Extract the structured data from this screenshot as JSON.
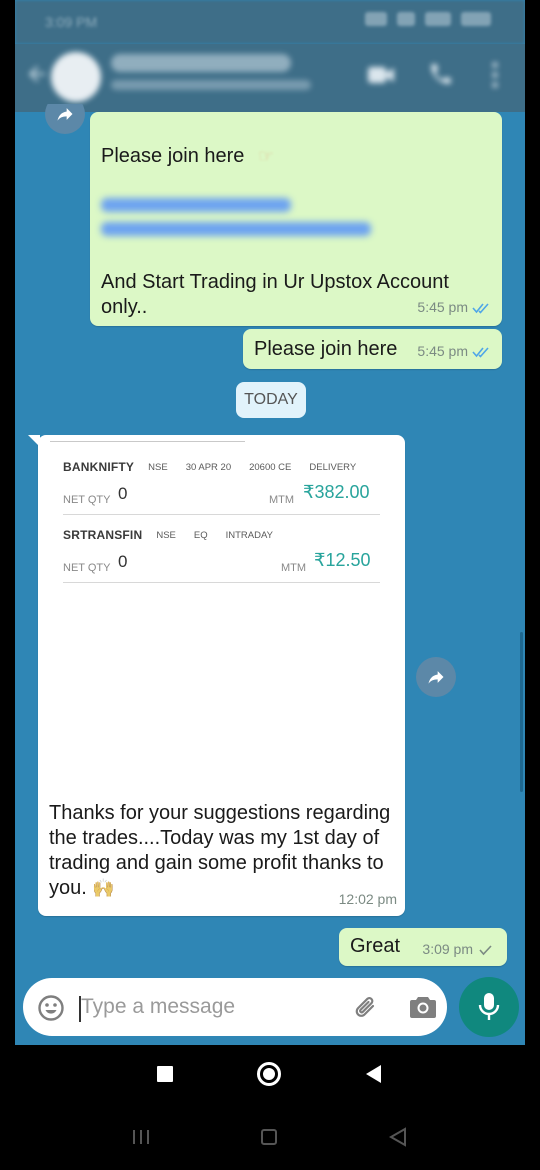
{
  "status_bar": {
    "time": "3:09 PM"
  },
  "header": {
    "contact": "",
    "subtitle": ""
  },
  "messages": {
    "m1": {
      "line1": "Please join here",
      "line2": "And Start Trading in Ur Upstox Account only..",
      "time": "5:45 pm"
    },
    "m2": {
      "text": "Please join here",
      "time": "5:45 pm"
    },
    "date_chip": "TODAY",
    "m3": {
      "positions": [
        {
          "symbol": "BANKNIFTY",
          "exchange": "NSE",
          "expiry": "30 APR 20",
          "strike": "20600 CE",
          "product": "DELIVERY",
          "net_qty_label": "NET QTY",
          "net_qty": "0",
          "mtm_label": "MTM",
          "mtm": "₹382.00"
        },
        {
          "symbol": "SRTRANSFIN",
          "exchange": "NSE",
          "segment": "EQ",
          "product": "INTRADAY",
          "net_qty_label": "NET QTY",
          "net_qty": "0",
          "mtm_label": "MTM",
          "mtm": "₹12.50"
        }
      ],
      "text": "Thanks for your suggestions regarding the trades....Today was my 1st day of trading and gain some profit thanks to you.",
      "time": "12:02 pm"
    },
    "m4": {
      "text": "Great",
      "time": "3:09 pm"
    }
  },
  "composer": {
    "placeholder": "Type a message"
  },
  "icons": {
    "back": "arrow-left-icon",
    "video": "video-camera-icon",
    "call": "phone-icon",
    "menu": "more-vertical-icon",
    "forward": "forward-arrow-icon",
    "emoji": "emoji-icon",
    "attach": "paperclip-icon",
    "camera": "camera-icon",
    "mic": "mic-icon"
  },
  "colors": {
    "chat_background": "#2f86b5",
    "outgoing_bubble": "#dcf8c6",
    "incoming_bubble": "#ffffff",
    "mtm_green": "#28a49c",
    "mic_button": "#10887e",
    "read_ticks": "#4fa6e8"
  }
}
